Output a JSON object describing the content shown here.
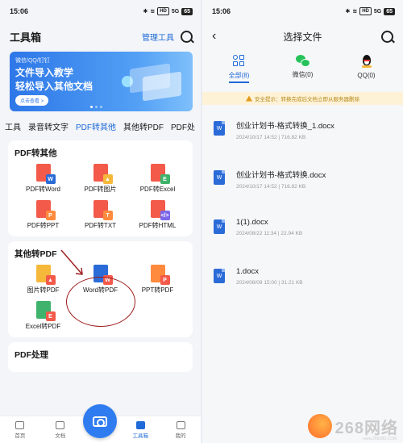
{
  "left": {
    "status": {
      "time": "15:06",
      "network": "5G",
      "battery": "65"
    },
    "header": {
      "title": "工具箱",
      "manage": "管理工具"
    },
    "banner": {
      "small": "微信/QQ/钉钉",
      "line1": "文件导入教学",
      "line2": "轻松导入其他文档",
      "button": "点击查看 >"
    },
    "tabs": [
      {
        "label": "工具"
      },
      {
        "label": "录音转文字"
      },
      {
        "label": "PDF转其他"
      },
      {
        "label": "其他转PDF"
      },
      {
        "label": "PDF处"
      }
    ],
    "section1": {
      "title": "PDF转其他",
      "items": [
        {
          "label": "PDF转Word",
          "badge": "W"
        },
        {
          "label": "PDF转图片",
          "badge": "▲"
        },
        {
          "label": "PDF转Excel",
          "badge": "E"
        },
        {
          "label": "PDF转PPT",
          "badge": "P"
        },
        {
          "label": "PDF转TXT",
          "badge": "T"
        },
        {
          "label": "PDF转HTML",
          "badge": "</>"
        }
      ]
    },
    "section2": {
      "title": "其他转PDF",
      "items": [
        {
          "label": "图片转PDF",
          "badge": "▲"
        },
        {
          "label": "Word转PDF",
          "badge": "W"
        },
        {
          "label": "PPT转PDF",
          "badge": "P"
        },
        {
          "label": "Excel转PDF",
          "badge": "E"
        }
      ]
    },
    "section3": {
      "title": "PDF处理"
    },
    "nav": [
      {
        "label": "首页"
      },
      {
        "label": "文档"
      },
      {
        "label": "工具箱"
      },
      {
        "label": "我的"
      }
    ],
    "colors": {
      "accent": "#1e6ad8",
      "annotation": "#9b1a1a"
    }
  },
  "right": {
    "status": {
      "time": "15:06",
      "network": "5G",
      "battery": "65"
    },
    "header": {
      "title": "选择文件"
    },
    "tabs": [
      {
        "label": "全部(8)"
      },
      {
        "label": "微信(0)"
      },
      {
        "label": "QQ(0)"
      }
    ],
    "notice": "安全提示：转换完成后文档立即从服务器删除",
    "files": [
      {
        "name": "创业计划书-格式转换_1.docx",
        "meta": "2024/10/17 14:52 | 716.82 KB"
      },
      {
        "name": "创业计划书-格式转换.docx",
        "meta": "2024/10/17 14:52 | 716.82 KB"
      },
      {
        "name": "1(1).docx",
        "meta": "2024/08/22 11:34 | 22.94 KB"
      },
      {
        "name": "1.docx",
        "meta": "2024/08/09 15:00 | 31.21 KB"
      }
    ],
    "watermark": {
      "text": "268网络",
      "url": "www.268280.COM"
    }
  }
}
